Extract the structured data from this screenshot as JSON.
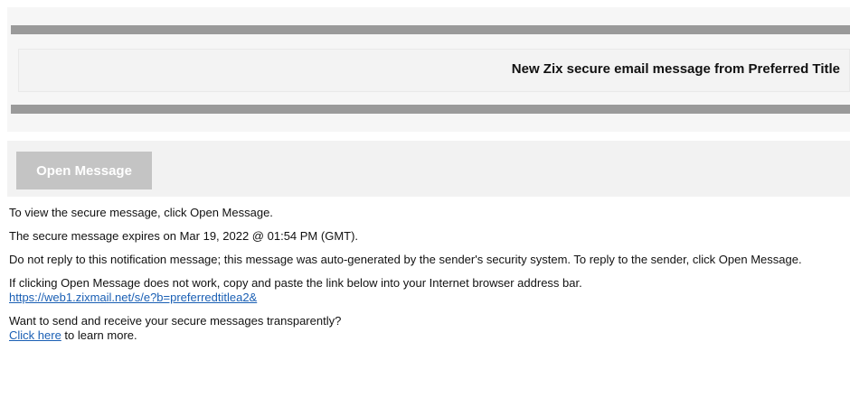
{
  "header": {
    "title": "New Zix secure email message from Preferred Title"
  },
  "open_button": {
    "label": "Open Message"
  },
  "body": {
    "line1": "To view the secure message, click Open Message.",
    "line2": "The secure message expires on Mar 19, 2022 @ 01:54 PM (GMT).",
    "line3": "Do not reply to this notification message; this message was auto-generated by the sender's security system. To reply to the sender, click Open Message.",
    "line4": "If clicking Open Message does not work, copy and paste the link below into your Internet browser address bar.",
    "link_url": "https://web1.zixmail.net/s/e?b=preferredtitlea2&",
    "line5": "Want to send and receive your secure messages transparently?",
    "click_here": "Click here",
    "learn_more": " to learn more."
  },
  "colors": {
    "bar": "#9a9a9a",
    "button_bg": "#c4c4c4",
    "link": "#1a5fb4"
  }
}
